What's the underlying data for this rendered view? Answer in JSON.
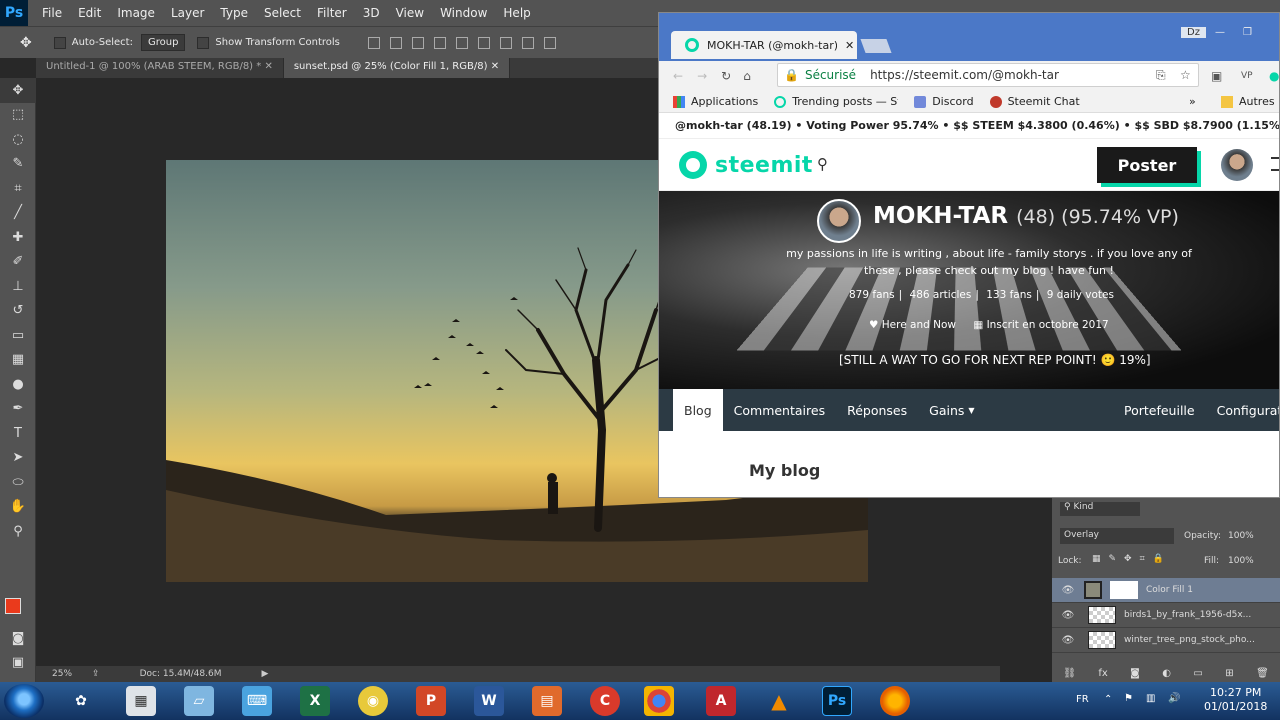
{
  "photoshop": {
    "logo": "Ps",
    "menus": [
      "File",
      "Edit",
      "Image",
      "Layer",
      "Type",
      "Select",
      "Filter",
      "3D",
      "View",
      "Window",
      "Help"
    ],
    "options": {
      "auto_select": "Auto-Select:",
      "group": "Group",
      "show_transform": "Show Transform Controls"
    },
    "tabs": [
      "Untitled-1 @ 100% (ARAB STEEM, RGB/8) *",
      "sunset.psd @ 25% (Color Fill 1, RGB/8)"
    ],
    "status": {
      "zoom": "25%",
      "doc": "Doc: 15.4M/48.6M"
    },
    "layers": {
      "filter": "Kind",
      "blend": "Overlay",
      "opacity_label": "Opacity:",
      "opacity": "100%",
      "lock_label": "Lock:",
      "fill_label": "Fill:",
      "fill": "100%",
      "items": [
        {
          "name": "Color Fill 1"
        },
        {
          "name": "birds1_by_frank_1956-d5x..."
        },
        {
          "name": "winter_tree_png_stock_pho..."
        }
      ]
    },
    "colors": {
      "foreground": "#ea3a1c",
      "background": "#000000"
    }
  },
  "browser": {
    "tab_title": "MOKH-TAR (@mokh-tar)",
    "secure": "Sécurisé",
    "url": "https://steemit.com/@mokh-tar",
    "bookmarks": [
      "Applications",
      "Trending posts — Ste",
      "Discord",
      "Steemit Chat"
    ],
    "other_bookmarks": "Autres",
    "ext_bar": "@mokh-tar (48.19) • Voting Power 95.74% • $$ STEEM $4.3800 (0.46%) • $$ SBD $8.7900 (1.15%)",
    "profile_name": "ZA",
    "win_badge": "Dz"
  },
  "steemit": {
    "logo": "steemit",
    "post_button": "Poster",
    "profile": {
      "name": "MOKH-TAR",
      "rep": "(48) (95.74% VP)",
      "about": "my passions in life is writing , about life - family storys . if you love any of these , please check out my blog ! have fun !",
      "fans": "879 fans",
      "articles": "486 articles",
      "following": "133 fans",
      "daily_votes": "9 daily votes",
      "location": "Here and Now",
      "joined": "Inscrit en octobre 2017",
      "progress": "[STILL A WAY TO GO FOR NEXT REP POINT! 🙂 19%]"
    },
    "nav_left": [
      "Blog",
      "Commentaires",
      "Réponses",
      "Gains"
    ],
    "nav_right": [
      "Portefeuille",
      "Configuration"
    ],
    "blog_title": "My blog"
  },
  "taskbar": {
    "lang": "FR",
    "time": "10:27 PM",
    "date": "01/01/2018"
  }
}
